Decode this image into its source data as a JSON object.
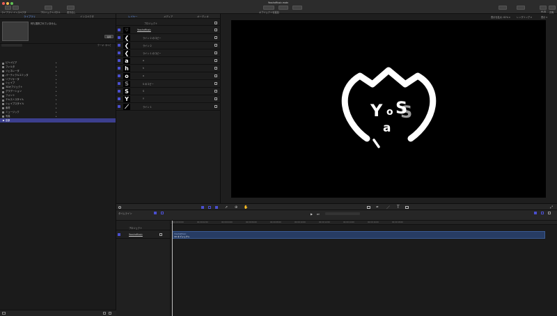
{
  "window": {
    "title": "YosshaMusic.motn"
  },
  "toolbar": {
    "library_label": "ライブラリ",
    "inspector_label": "インスペクタ",
    "project_panel_label": "プロジェクトパネル",
    "timing_label": "書き出し",
    "add_object_label": "オブジェクトを追加",
    "hud_label": "HUD",
    "share_label": "共有"
  },
  "browser": {
    "tabs": [
      "ライブラリ",
      "インスペクタ"
    ],
    "active_tab": "ライブラリ",
    "no_selection_text": "何も選択されていません。",
    "apply_button": "適用",
    "theme_label": "テーマ: すべて",
    "categories": [
      "ビヘイビア",
      "フィルタ",
      "ジェネレータ",
      "パーティクルエミッタ",
      "リプリケータ",
      "シェイプ",
      "3Dオブジェクト",
      "グラデーション",
      "フォント",
      "テキストスタイル",
      "シェイプスタイル",
      "素材",
      "ミュージック",
      "写真",
      "コンテンツ"
    ],
    "selected_row": "▶ 全部"
  },
  "layers": {
    "tabs": [
      "レイヤー",
      "メディア",
      "オーディオ"
    ],
    "active_tab": "レイヤー",
    "project_label": "プロジェクト",
    "group_label": "YosshaMusic",
    "rows": [
      {
        "thumb": "❮",
        "name": "ライン 2 のコピー"
      },
      {
        "thumb": "❮",
        "name": "ライン 2"
      },
      {
        "thumb": "❮",
        "name": "ライン 1 のコピー"
      },
      {
        "thumb": "a",
        "name": "a"
      },
      {
        "thumb": "h",
        "name": "h"
      },
      {
        "thumb": "o",
        "name": "o"
      },
      {
        "thumb": "S",
        "name": "S のコピー"
      },
      {
        "thumb": "S",
        "name": "S"
      },
      {
        "thumb": "Y",
        "name": "Y"
      },
      {
        "thumb": "⟋",
        "name": "ライン 1"
      }
    ]
  },
  "viewer": {
    "zoom_label": "表示を拡大: 82% ▾",
    "render_label": "レンダリング ▾",
    "view_label": "表示 ▾",
    "logo_letters": {
      "y": "Y",
      "o": "o",
      "s": "S",
      "a": "a"
    }
  },
  "timeline": {
    "tab_label": "タイムライン",
    "project_row": "プロジェクト",
    "group_row": "YosshaMusic",
    "clip_label": "YosshaMusic",
    "clip_sub": "10 オブジェクト",
    "ruler_ticks": [
      "00:00:00:00",
      "00:00:02:00",
      "00:00:04:00",
      "00:00:06:00",
      "00:00:08:00",
      "00:00:10:00",
      "00:00:12:00",
      "00:00:14:00",
      "00:00:16:00",
      "00:00:18:00"
    ]
  },
  "colors": {
    "accent": "#4a4fd0",
    "selection": "#3c3f8e",
    "clip": "#273c63"
  }
}
